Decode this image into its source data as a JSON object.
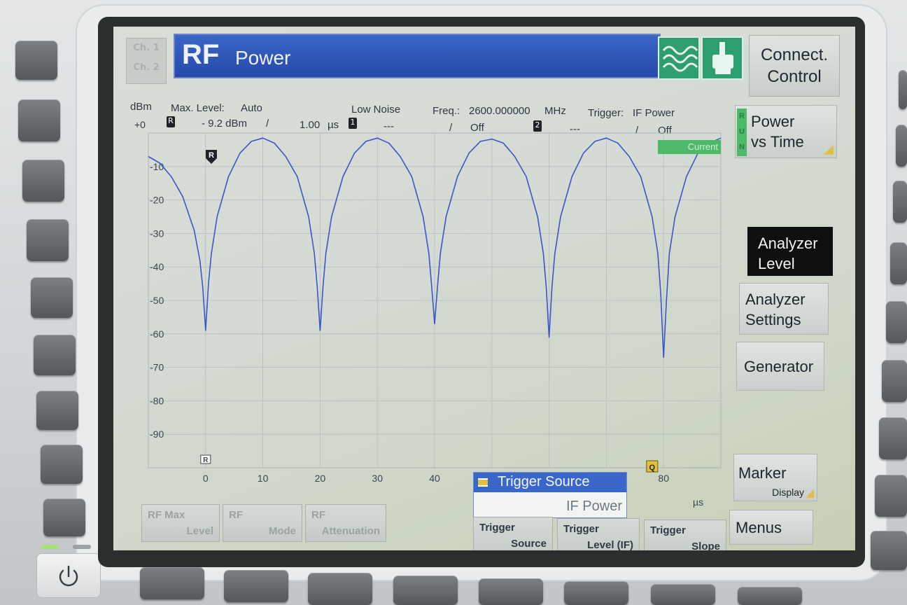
{
  "channels": [
    "Ch. 1",
    "Ch. 2"
  ],
  "title": {
    "main": "RF",
    "sub": "Power"
  },
  "icons": [
    "rf-wave-icon",
    "hand-pointer-icon",
    "trigger-q-icon",
    "power-icon"
  ],
  "connect_control": {
    "line1": "Connect.",
    "line2": "Control"
  },
  "right_softkeys": {
    "power_vs_time": {
      "line1": "Power",
      "line2": "vs Time",
      "run_letters": [
        "R",
        "U",
        "N"
      ]
    },
    "analyzer_level": {
      "line1": "Analyzer",
      "line2": "Level"
    },
    "analyzer_settings": {
      "line1": "Analyzer",
      "line2": "Settings"
    },
    "generator": {
      "line1": "Generator"
    },
    "marker": {
      "line1": "Marker",
      "line2": "Display"
    },
    "menus": {
      "line1": "Menus"
    }
  },
  "header": {
    "unit": "dBm",
    "max_level_label": "Max. Level:",
    "max_level_value": "Auto",
    "low_noise": "Low Noise",
    "freq_label": "Freq.:",
    "freq_value": "2600.000000",
    "freq_unit": "MHz",
    "trigger_label": "Trigger:",
    "trigger_value": "IF Power",
    "top_value": "+0",
    "marker_r_value": "- 9.2 dBm",
    "marker_r_sep": "/",
    "marker_r_time": "1.00",
    "marker_r_time_unit": "µs",
    "marker1_value": "---",
    "marker1_sep": "/",
    "marker1_state": "Off",
    "marker2_value": "---",
    "marker2_sep": "/",
    "marker2_state": "Off",
    "current_label": "Current"
  },
  "markers": {
    "r": "R",
    "m1": "1",
    "m2": "2",
    "q": "Q"
  },
  "bottom_softkeys": [
    {
      "line1": "RF Max",
      "line2": "Level",
      "enabled": false
    },
    {
      "line1": "RF",
      "line2": "Mode",
      "enabled": false
    },
    {
      "line1": "RF",
      "line2": "Attenuation",
      "enabled": false
    },
    {
      "line1": "Trigger",
      "line2": "Source",
      "enabled": true
    },
    {
      "line1": "Trigger",
      "line2": "Level (IF)",
      "enabled": true
    },
    {
      "line1": "Trigger",
      "line2": "Slope",
      "enabled": true
    }
  ],
  "popup": {
    "title": "Trigger Source",
    "value": "IF Power"
  },
  "chart_data": {
    "type": "line",
    "xlabel": "µs",
    "ylabel": "dBm",
    "xlim": [
      -10,
      90
    ],
    "ylim": [
      -100,
      0
    ],
    "x_ticks": [
      0,
      10,
      20,
      30,
      40,
      80
    ],
    "y_ticks": [
      -10,
      -20,
      -30,
      -40,
      -50,
      -60,
      -70,
      -80,
      -90
    ],
    "y_top_label": "+0",
    "grid": true,
    "colors": {
      "trace": "#3a56c9",
      "grid": "#b4bcc4",
      "current": "#4fb96a"
    },
    "series": [
      {
        "name": "Current",
        "x": [
          -10,
          -8,
          -6,
          -4,
          -2,
          -1,
          -0.5,
          0,
          0.5,
          1,
          2,
          4,
          6,
          8,
          10,
          12,
          14,
          16,
          18,
          19,
          19.5,
          20,
          20.5,
          21,
          22,
          24,
          26,
          28,
          30,
          32,
          34,
          36,
          38,
          39,
          39.5,
          40,
          40.5,
          41,
          42,
          44,
          46,
          48,
          50,
          52,
          54,
          56,
          58,
          59,
          59.5,
          60,
          60.5,
          61,
          62,
          64,
          66,
          68,
          70,
          72,
          74,
          76,
          78,
          79,
          79.5,
          80,
          80.5,
          81,
          82,
          84,
          86,
          88,
          90
        ],
        "y": [
          -7,
          -9,
          -13,
          -19,
          -29,
          -38,
          -46,
          -59,
          -45,
          -36,
          -25,
          -13,
          -6,
          -2.5,
          -1.5,
          -3,
          -7,
          -13,
          -25,
          -36,
          -46,
          -59,
          -46,
          -36,
          -25,
          -13,
          -6,
          -2.5,
          -1.5,
          -3,
          -7,
          -13,
          -25,
          -36,
          -46,
          -57,
          -46,
          -36,
          -25,
          -13,
          -6,
          -2.5,
          -1.8,
          -3,
          -7,
          -13,
          -25,
          -36,
          -46,
          -61,
          -46,
          -36,
          -25,
          -13,
          -6,
          -2.5,
          -1.5,
          -3,
          -7,
          -13,
          -25,
          -36,
          -48,
          -67,
          -50,
          -36,
          -25,
          -13,
          -6,
          -3,
          -1.5
        ]
      }
    ]
  }
}
